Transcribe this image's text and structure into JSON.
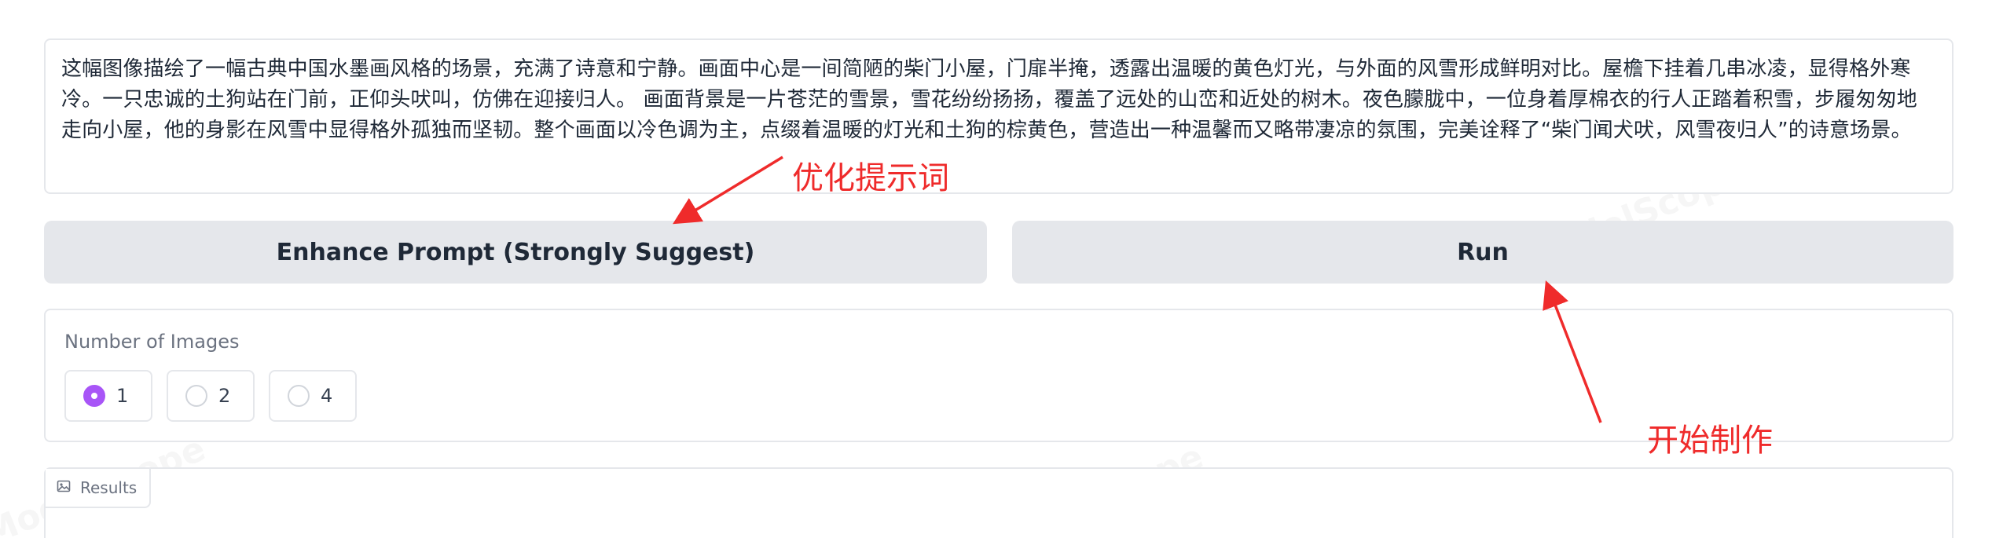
{
  "prompt": {
    "text": "这幅图像描绘了一幅古典中国水墨画风格的场景，充满了诗意和宁静。画面中心是一间简陋的柴门小屋，门扉半掩，透露出温暖的黄色灯光，与外面的风雪形成鲜明对比。屋檐下挂着几串冰凌，显得格外寒冷。一只忠诚的土狗站在门前，正仰头吠叫，仿佛在迎接归人。 画面背景是一片苍茫的雪景，雪花纷纷扬扬，覆盖了远处的山峦和近处的树木。夜色朦胧中，一位身着厚棉衣的行人正踏着积雪，步履匆匆地走向小屋，他的身影在风雪中显得格外孤独而坚韧。整个画面以冷色调为主，点缀着温暖的灯光和土狗的棕黄色，营造出一种温馨而又略带凄凉的氛围，完美诠释了“柴门闻犬吠，风雪夜归人”的诗意场景。"
  },
  "buttons": {
    "enhance_label": "Enhance Prompt (Strongly Suggest)",
    "run_label": "Run"
  },
  "num_images": {
    "label": "Number of Images",
    "options": [
      "1",
      "2",
      "4"
    ],
    "selected": "1"
  },
  "results": {
    "label": "Results",
    "icon": "image-icon"
  },
  "annotations": {
    "enhance": "优化提示词",
    "run": "开始制作"
  },
  "watermark": "ModelScope",
  "colors": {
    "accent": "#a855f7",
    "button_bg": "#e5e7eb",
    "border": "#e5e7eb",
    "annotation": "#ef2b2b"
  }
}
